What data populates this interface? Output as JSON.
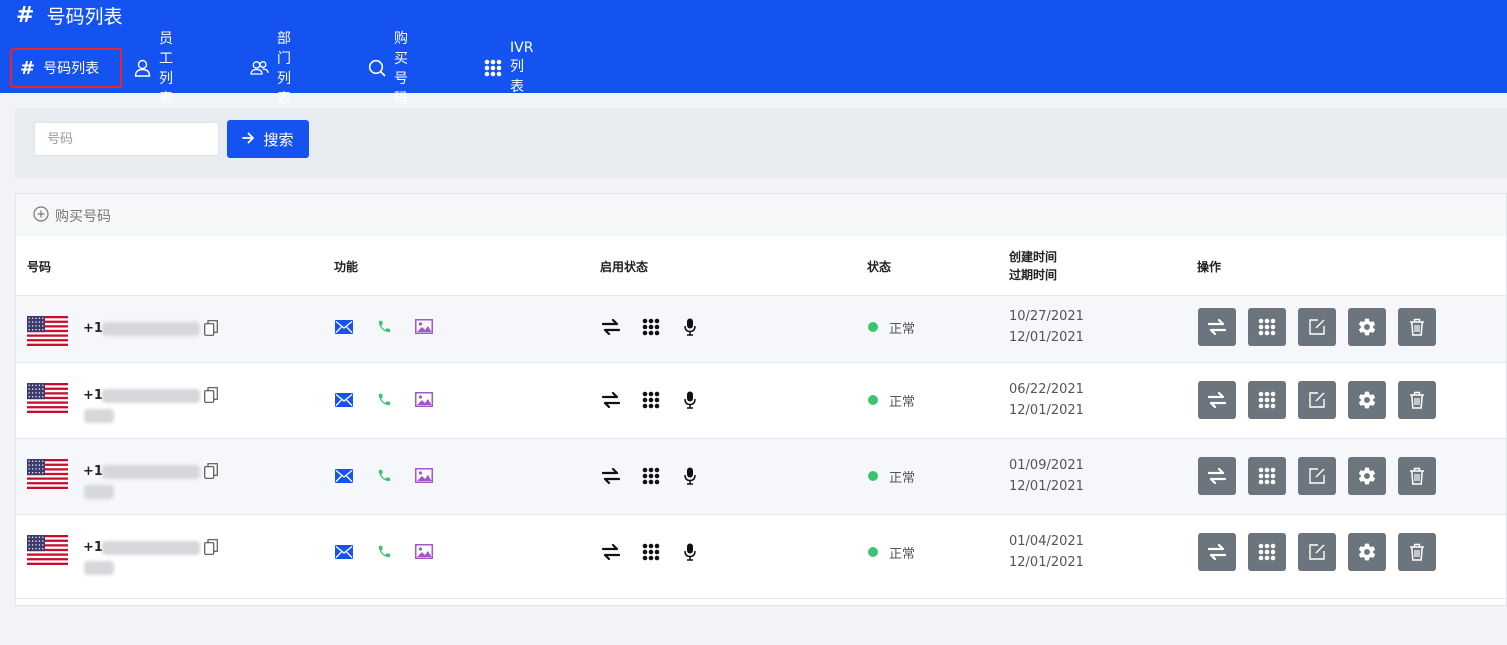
{
  "header": {
    "title": "号码列表",
    "title_icon": "hash-icon"
  },
  "nav": [
    {
      "label": "号码列表",
      "icon": "hash-icon",
      "active": true
    },
    {
      "label": "员工列表",
      "icon": "user-icon"
    },
    {
      "label": "部门列表",
      "icon": "users-icon"
    },
    {
      "label": "购买号码",
      "icon": "search-icon"
    },
    {
      "label": "IVR列表",
      "icon": "grid-icon"
    }
  ],
  "search": {
    "placeholder": "号码",
    "button_label": "搜索"
  },
  "panel": {
    "buy_label": "购买号码"
  },
  "table": {
    "columns": {
      "number": "号码",
      "function": "功能",
      "enabled": "启用状态",
      "status": "状态",
      "created": "创建时间",
      "expires": "过期时间",
      "actions": "操作"
    },
    "rows": [
      {
        "prefix": "+1",
        "status": "正常",
        "created": "10/27/2021",
        "expires": "12/01/2021"
      },
      {
        "prefix": "+1",
        "status": "正常",
        "created": "06/22/2021",
        "expires": "12/01/2021"
      },
      {
        "prefix": "+1",
        "status": "正常",
        "created": "01/09/2021",
        "expires": "12/01/2021"
      },
      {
        "prefix": "+1",
        "status": "正常",
        "created": "01/04/2021",
        "expires": "12/01/2021"
      }
    ]
  },
  "colors": {
    "primary": "#1553f0",
    "status_ok": "#3cc36e",
    "action_btn": "#6c757d",
    "active_border": "#e8232a"
  }
}
